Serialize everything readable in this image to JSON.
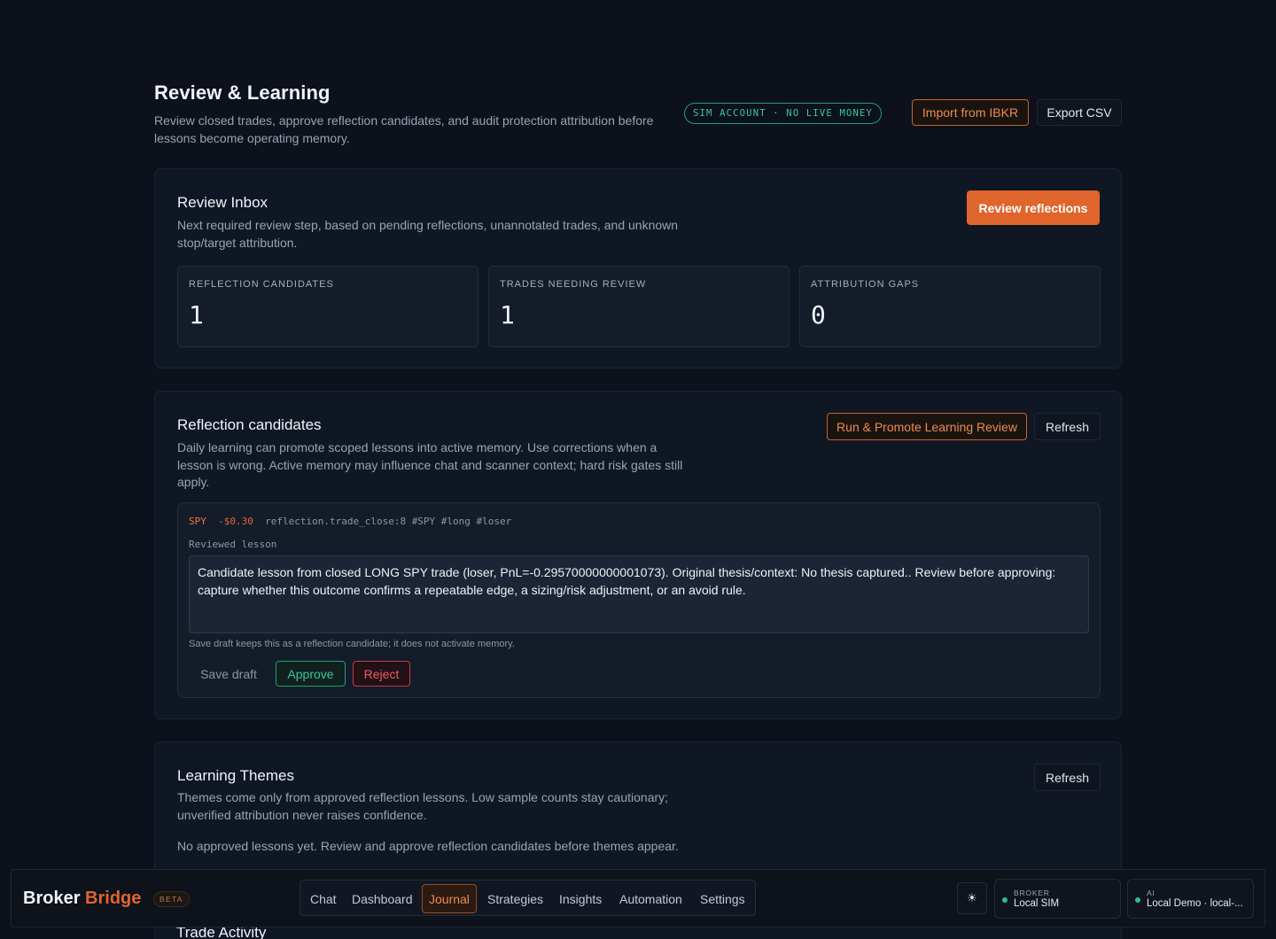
{
  "header": {
    "title": "Review & Learning",
    "subtitle": "Review closed trades, approve reflection candidates, and audit protection attribution before lessons become operating memory.",
    "sim_badge": "SIM ACCOUNT · NO LIVE MONEY",
    "import_label": "Import from IBKR",
    "export_label": "Export CSV"
  },
  "inbox": {
    "title": "Review Inbox",
    "description": "Next required review step, based on pending reflections, unannotated trades, and unknown stop/target attribution.",
    "action_label": "Review reflections",
    "stats": [
      {
        "label": "REFLECTION CANDIDATES",
        "value": "1"
      },
      {
        "label": "TRADES NEEDING REVIEW",
        "value": "1"
      },
      {
        "label": "ATTRIBUTION GAPS",
        "value": "0"
      }
    ]
  },
  "reflections": {
    "title": "Reflection candidates",
    "description": "Daily learning can promote scoped lessons into active memory. Use corrections when a lesson is wrong. Active memory may influence chat and scanner context; hard risk gates still apply.",
    "run_label": "Run & Promote Learning Review",
    "refresh_label": "Refresh",
    "candidate": {
      "symbol": "SPY",
      "pnl": "-$0.30",
      "meta": "reflection.trade_close:8 #SPY #long #loser",
      "field_label": "Reviewed lesson",
      "lesson": "Candidate lesson from closed LONG SPY trade (loser, PnL=-0.29570000000001073). Original thesis/context: No thesis captured.. Review before approving: capture whether this outcome confirms a repeatable edge, a sizing/risk adjustment, or an avoid rule.",
      "note": "Save draft keeps this as a reflection candidate; it does not activate memory.",
      "save_label": "Save draft",
      "approve_label": "Approve",
      "reject_label": "Reject"
    }
  },
  "themes": {
    "title": "Learning Themes",
    "description": "Themes come only from approved reflection lessons. Low sample counts stay cautionary; unverified attribution never raises confidence.",
    "refresh_label": "Refresh",
    "empty": "No approved lessons yet. Review and approve reflection candidates before themes appear."
  },
  "trade_activity": {
    "title": "Trade Activity"
  },
  "navbar": {
    "brand_1": "Broker",
    "brand_2": "Bridge",
    "beta": "BETA",
    "tabs": [
      "Chat",
      "Dashboard",
      "Journal",
      "Strategies",
      "Insights",
      "Automation",
      "Settings"
    ],
    "active_tab": "Journal",
    "theme_icon": "sun-icon",
    "broker_key": "BROKER",
    "broker_value": "Local SIM",
    "ai_key": "AI",
    "ai_value": "Local Demo · local-..."
  },
  "colors": {
    "accent": "#e0652d",
    "success": "#37c99d",
    "danger": "#f05a63",
    "background": "#0c111b"
  }
}
